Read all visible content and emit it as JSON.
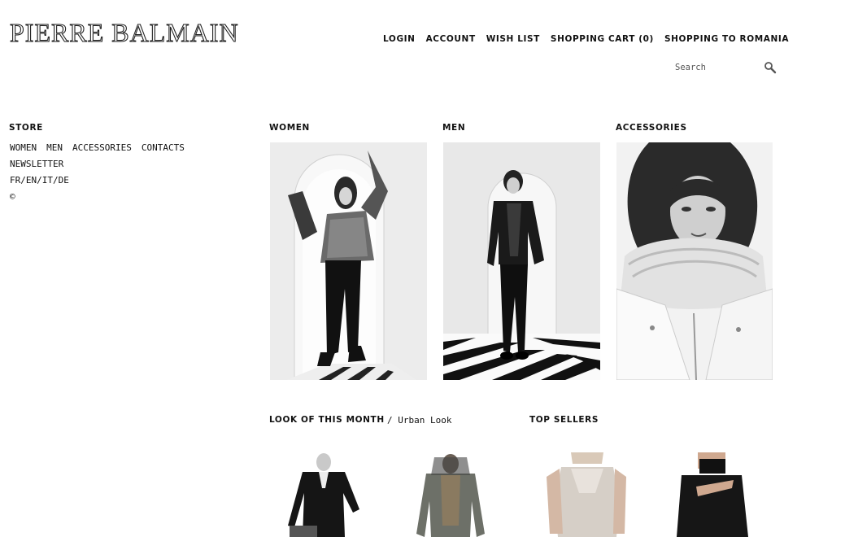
{
  "brand": {
    "logo_text": "PIERRE BALMAIN"
  },
  "topnav": {
    "login": "LOGIN",
    "account": "ACCOUNT",
    "wishlist": "WISH LIST",
    "cart": "SHOPPING CART (0)",
    "shipping": "SHOPPING TO ROMANIA"
  },
  "search": {
    "placeholder": "Search"
  },
  "store": {
    "title": "STORE",
    "links": [
      "WOMEN",
      "MEN",
      "ACCESSORIES",
      "CONTACTS"
    ],
    "newsletter": "NEWSLETTER",
    "languages": "FR/EN/IT/DE",
    "copyright": "©"
  },
  "categories": {
    "women": "WOMEN",
    "men": "MEN",
    "accessories": "ACCESSORIES"
  },
  "look": {
    "title": "LOOK OF THIS MONTH",
    "subtitle": "/ Urban Look"
  },
  "top_sellers": {
    "title": "TOP SELLERS"
  }
}
